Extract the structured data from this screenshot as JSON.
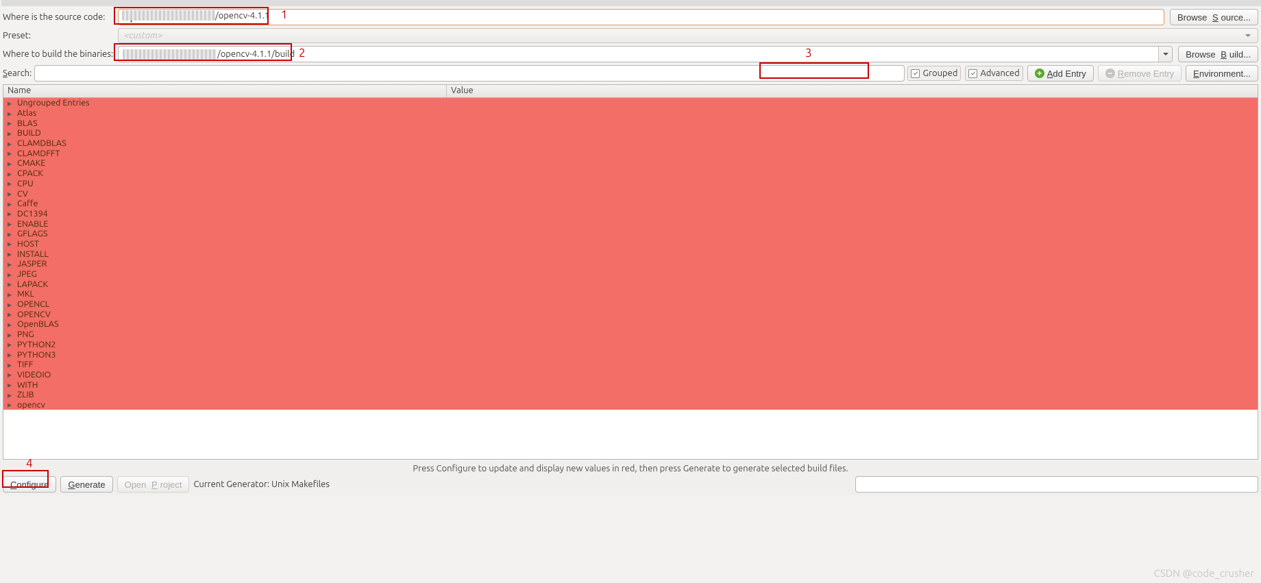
{
  "source_row": {
    "label": "Where is the source code:",
    "value_suffix": "/opencv-4.1.1",
    "browse": "Browse Source..."
  },
  "preset_row": {
    "label": "Preset:",
    "placeholder": "<custom>"
  },
  "build_row": {
    "label": "Where to build the binaries:",
    "value_suffix": "/opencv-4.1.1/build",
    "browse": "Browse Build..."
  },
  "search_row": {
    "label": "Search:"
  },
  "toolbar": {
    "grouped": "Grouped",
    "advanced": "Advanced",
    "add_entry": "Add Entry",
    "remove_entry": "Remove Entry",
    "environment": "Environment..."
  },
  "table": {
    "col_name": "Name",
    "col_value": "Value",
    "groups": [
      "Ungrouped Entries",
      "Atlas",
      "BLAS",
      "BUILD",
      "CLAMDBLAS",
      "CLAMDFFT",
      "CMAKE",
      "CPACK",
      "CPU",
      "CV",
      "Caffe",
      "DC1394",
      "ENABLE",
      "GFLAGS",
      "HOST",
      "INSTALL",
      "JASPER",
      "JPEG",
      "LAPACK",
      "MKL",
      "OPENCL",
      "OPENCV",
      "OpenBLAS",
      "PNG",
      "PYTHON2",
      "PYTHON3",
      "TIFF",
      "VIDEOIO",
      "WITH",
      "ZLIB",
      "opencv"
    ]
  },
  "message": "Press Configure to update and display new values in red, then press Generate to generate selected build files.",
  "bottom": {
    "configure": "Configure",
    "generate": "Generate",
    "open_project": "Open Project",
    "generator_label": "Current Generator: Unix Makefiles"
  },
  "annotations": {
    "a1": "1",
    "a2": "2",
    "a3": "3",
    "a4": "4"
  },
  "watermark": "CSDN @code_crusher",
  "letters": {
    "S": "S",
    "B": "B",
    "e": "e",
    "A": "A",
    "R": "R",
    "E": "E",
    "C": "C",
    "G": "G",
    "P": "P"
  }
}
